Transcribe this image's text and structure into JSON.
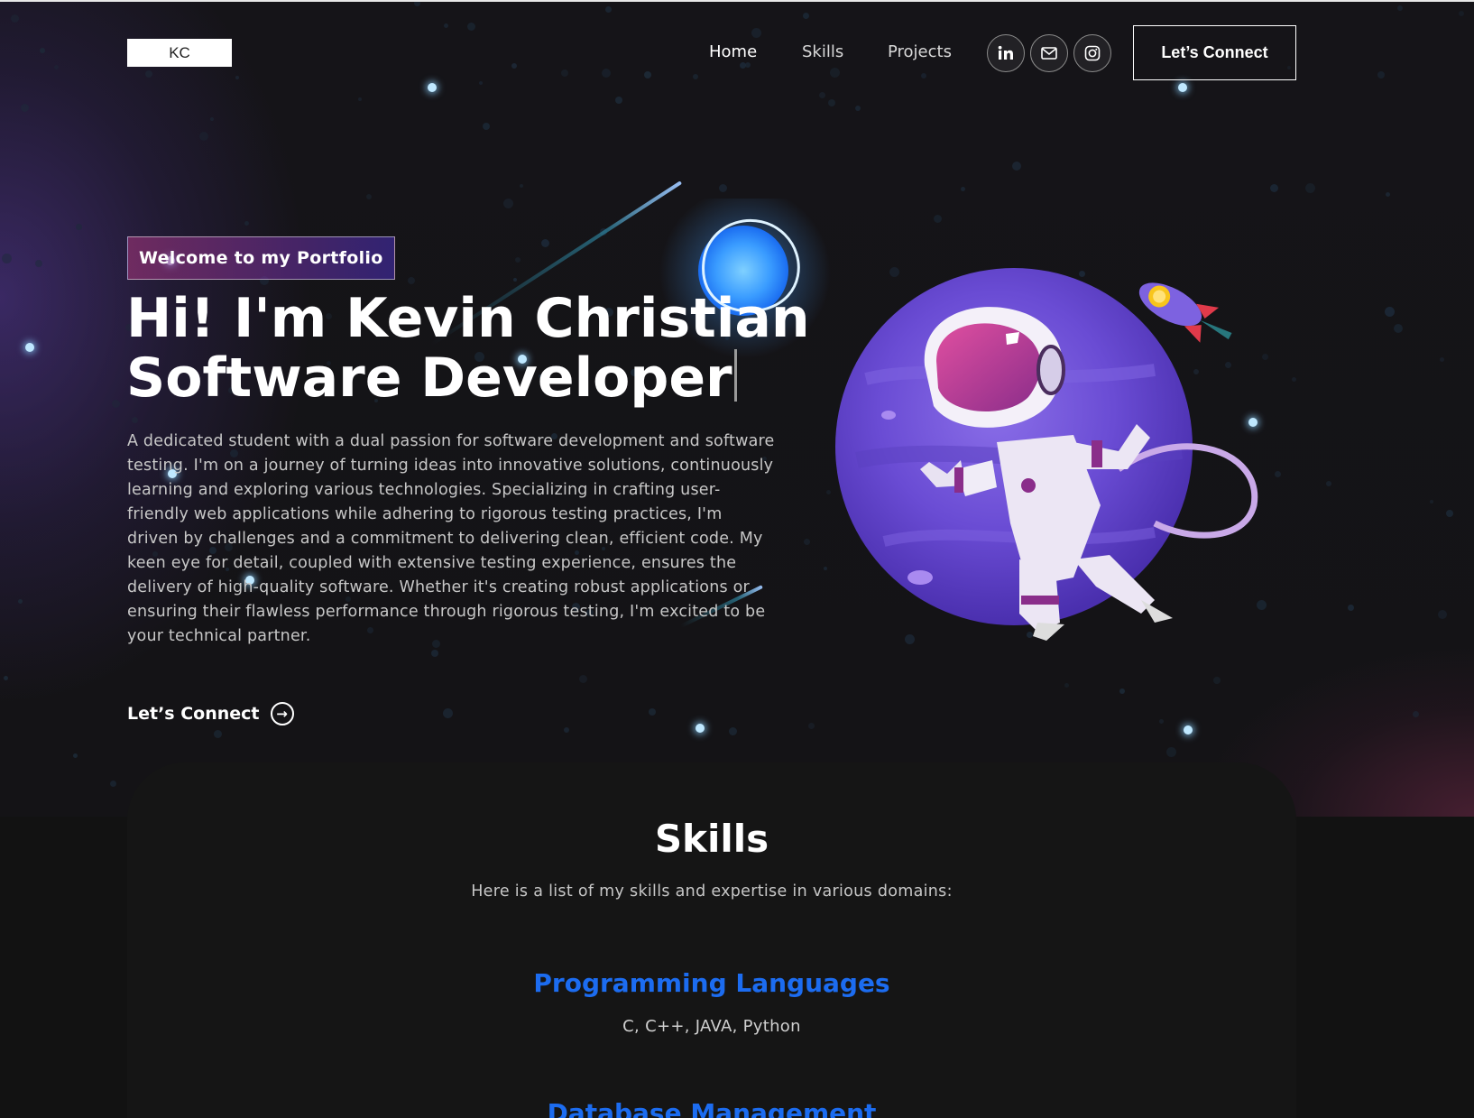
{
  "nav": {
    "logo": "KC",
    "links": [
      "Home",
      "Skills",
      "Projects"
    ],
    "socials": [
      "linkedin-icon",
      "mail-icon",
      "instagram-icon"
    ],
    "cta_label": "Let’s Connect"
  },
  "hero": {
    "tagline": "Welcome to my Portfolio",
    "headline_line1": "Hi! I'm Kevin Christian",
    "headline_line2": "Software Developer",
    "intro": "A dedicated student with a dual passion for software development and software testing. I'm on a journey of turning ideas into innovative solutions, continuously learning and exploring various technologies. Specializing in crafting user-friendly web applications while adhering to rigorous testing practices, I'm driven by challenges and a commitment to delivering clean, efficient code. My keen eye for detail, coupled with extensive testing experience, ensures the delivery of high-quality software. Whether it's creating robust applications or ensuring their flawless performance through rigorous testing, I'm excited to be your technical partner.",
    "cta_label": "Let’s Connect"
  },
  "skills": {
    "title": "Skills",
    "subtitle": "Here is a list of my skills and expertise in various domains:",
    "categories": [
      {
        "title": "Programming Languages",
        "items": "C, C++, JAVA, Python"
      },
      {
        "title": "Database Management",
        "items": ""
      }
    ]
  },
  "colors": {
    "background": "#121212",
    "accent_blue": "#1c6cf0",
    "tagline_gradient_start": "#aa367c",
    "tagline_gradient_end": "#4a2fbd"
  }
}
